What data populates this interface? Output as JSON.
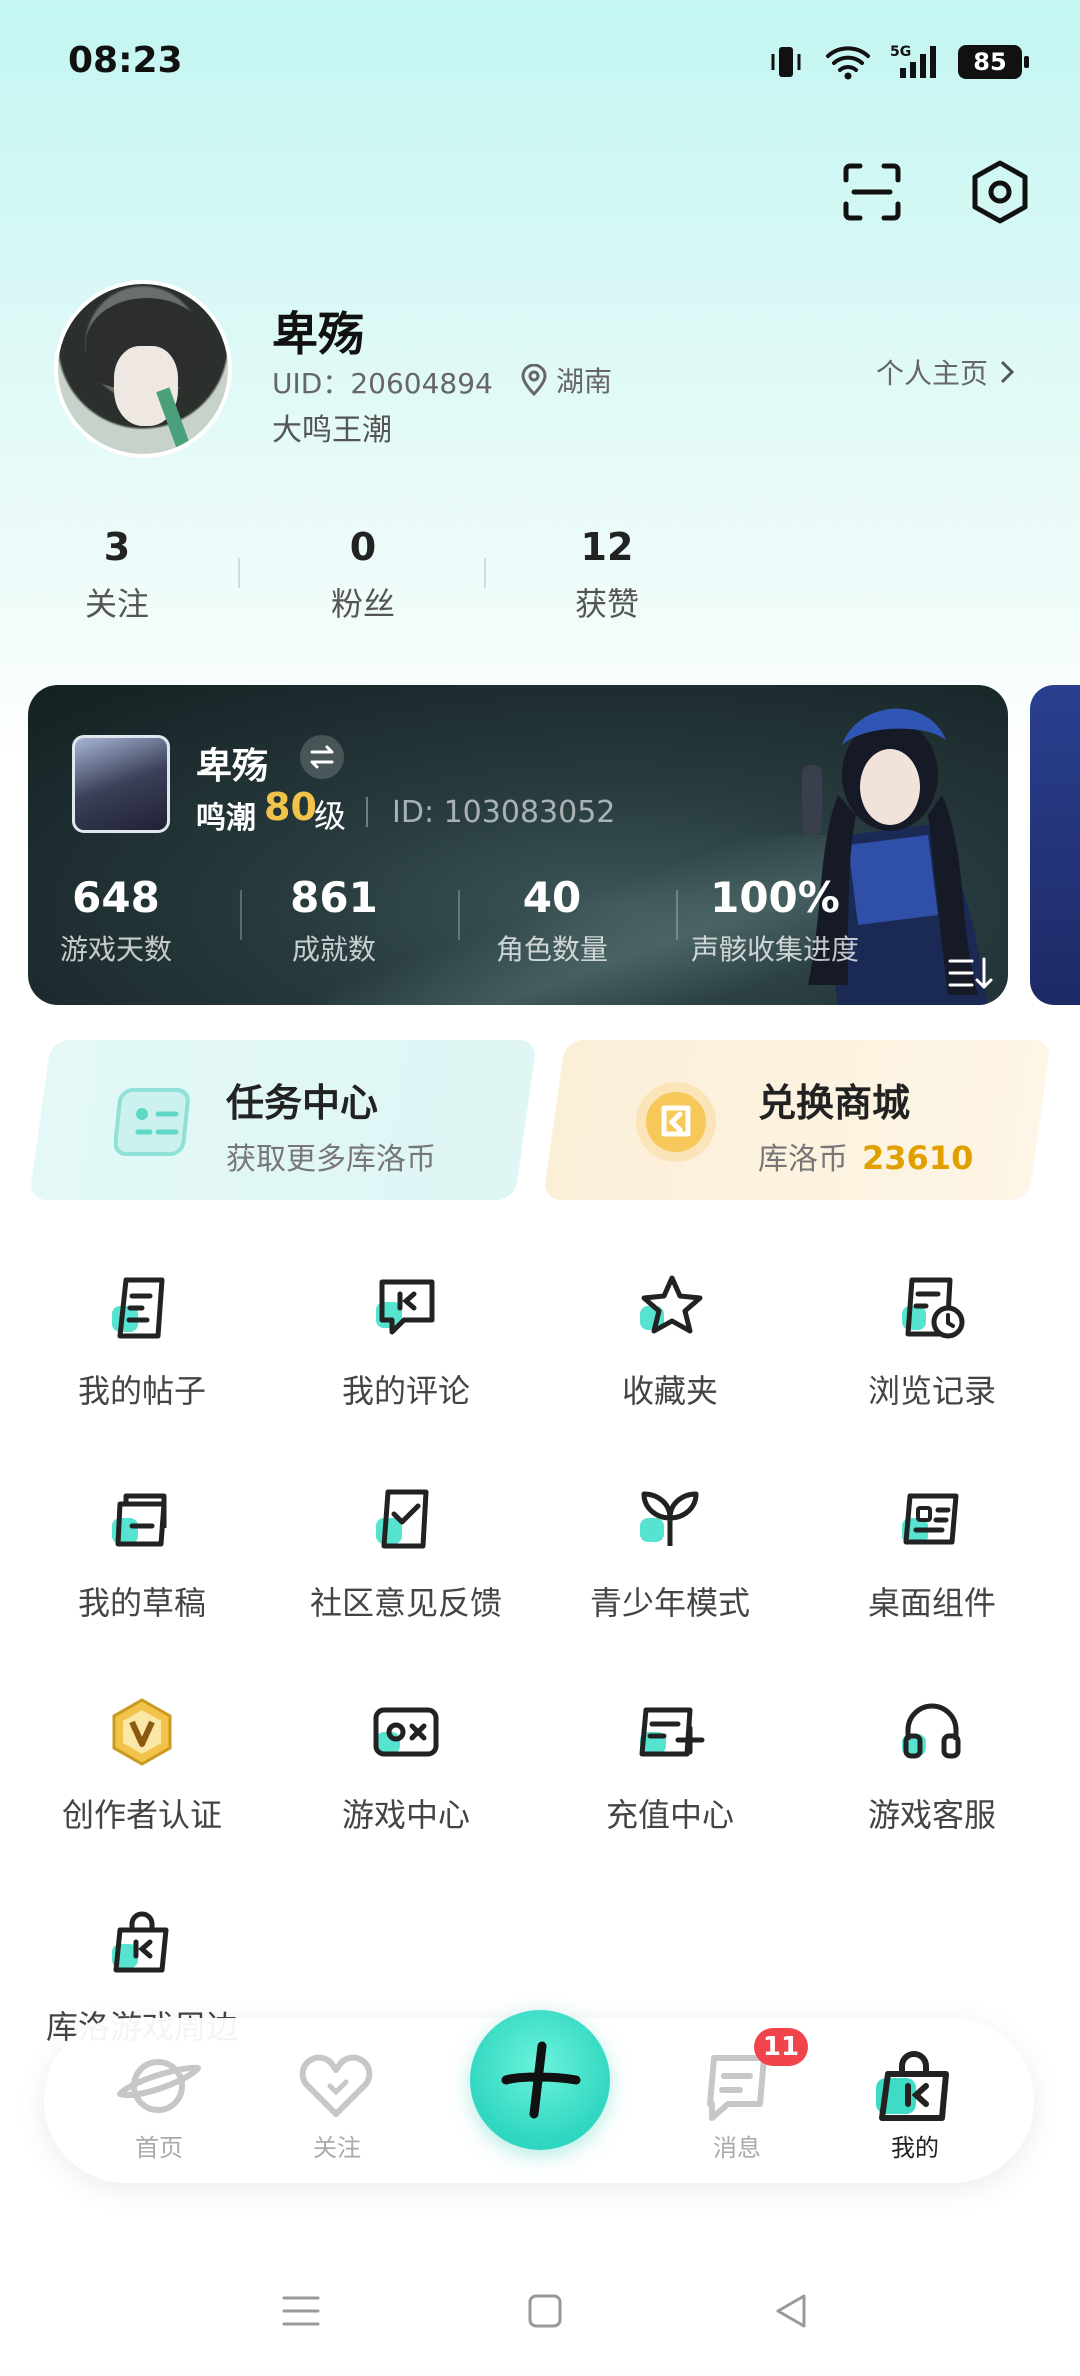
{
  "status_bar": {
    "time": "08:23",
    "network": "5G",
    "battery": "85"
  },
  "profile": {
    "name": "卑殇",
    "uid": "UID：20604894",
    "location": "湖南",
    "signature": "大鸣王潮",
    "homepage_label": "个人主页"
  },
  "stats": [
    {
      "value": "3",
      "label": "关注"
    },
    {
      "value": "0",
      "label": "粉丝"
    },
    {
      "value": "12",
      "label": "获赞"
    }
  ],
  "game_card": {
    "name": "卑殇",
    "server": "鸣潮",
    "level": "80",
    "level_unit": "级",
    "game_id": "ID: 103083052",
    "stats": [
      {
        "value": "648",
        "label": "游戏天数"
      },
      {
        "value": "861",
        "label": "成就数"
      },
      {
        "value": "40",
        "label": "角色数量"
      },
      {
        "value": "100%",
        "label": "声骸收集进度"
      }
    ]
  },
  "task_card": {
    "title": "任务中心",
    "subtitle": "获取更多库洛币"
  },
  "shop_card": {
    "title": "兑换商城",
    "subtitle": "库洛币",
    "coins": "23610"
  },
  "grid": [
    {
      "label": "我的帖子",
      "icon": "post-icon"
    },
    {
      "label": "我的评论",
      "icon": "comment-icon"
    },
    {
      "label": "收藏夹",
      "icon": "star-icon"
    },
    {
      "label": "浏览记录",
      "icon": "history-icon"
    },
    {
      "label": "我的草稿",
      "icon": "draft-icon"
    },
    {
      "label": "社区意见反馈",
      "icon": "feedback-icon"
    },
    {
      "label": "青少年模式",
      "icon": "sprout-icon"
    },
    {
      "label": "桌面组件",
      "icon": "widget-icon"
    },
    {
      "label": "创作者认证",
      "icon": "creator-badge-icon"
    },
    {
      "label": "游戏中心",
      "icon": "gamepad-icon"
    },
    {
      "label": "充值中心",
      "icon": "wallet-add-icon"
    },
    {
      "label": "游戏客服",
      "icon": "headset-icon"
    },
    {
      "label": "库洛游戏周边",
      "icon": "shopping-bag-icon"
    }
  ],
  "bottom_nav": [
    {
      "label": "首页",
      "icon": "planet-icon"
    },
    {
      "label": "关注",
      "icon": "heart-icon"
    },
    {
      "label": "消息",
      "icon": "message-icon",
      "badge": "11"
    },
    {
      "label": "我的",
      "icon": "me-icon"
    }
  ],
  "colors": {
    "accent": "#3edcc6",
    "gold": "#e0a100",
    "badge": "#f0444a",
    "card_dark": "#1d2c2f"
  }
}
